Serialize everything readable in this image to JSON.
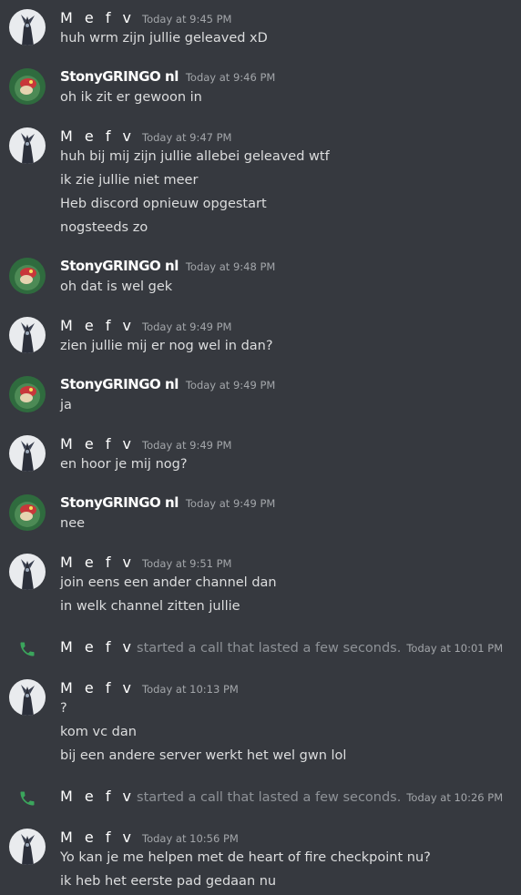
{
  "users": {
    "mefv": "M e f v",
    "stony": "StonyGRINGO nl"
  },
  "messages": [
    {
      "user": "M e f v",
      "time": "Today at 9:45 PM",
      "lines": [
        "huh wrm zijn jullie geleaved xD"
      ]
    },
    {
      "user": "StonyGRINGO nl",
      "time": "Today at 9:46 PM",
      "lines": [
        "oh ik zit er gewoon in"
      ]
    },
    {
      "user": "M e f v",
      "time": "Today at 9:47 PM",
      "lines": [
        "huh bij mij zijn jullie allebei geleaved wtf",
        "ik zie jullie niet meer",
        "Heb discord opnieuw opgestart",
        "nogsteeds zo"
      ]
    },
    {
      "user": "StonyGRINGO nl",
      "time": "Today at 9:48 PM",
      "lines": [
        "oh dat is wel gek"
      ]
    },
    {
      "user": "M e f v",
      "time": "Today at 9:49 PM",
      "lines": [
        "zien jullie mij er nog wel in dan?"
      ]
    },
    {
      "user": "StonyGRINGO nl",
      "time": "Today at 9:49 PM",
      "lines": [
        "ja"
      ]
    },
    {
      "user": "M e f v",
      "time": "Today at 9:49 PM",
      "lines": [
        "en hoor je mij nog?"
      ]
    },
    {
      "user": "StonyGRINGO nl",
      "time": "Today at 9:49 PM",
      "lines": [
        "nee"
      ]
    },
    {
      "user": "M e f v",
      "time": "Today at 9:51 PM",
      "lines": [
        "join eens een ander channel dan",
        "in welk channel zitten jullie"
      ]
    },
    {
      "user": "M e f v",
      "time": "Today at 10:13 PM",
      "lines": [
        "?",
        "kom vc dan",
        "bij een andere server werkt het wel gwn lol"
      ]
    },
    {
      "user": "M e f v",
      "time": "Today at 10:56 PM",
      "lines": [
        "Yo kan je me helpen met de heart of fire checkpoint nu?",
        "ik heb het eerste pad gedaan nu"
      ]
    }
  ],
  "calls": [
    {
      "user": "M e f v",
      "text": "started a call that lasted a few seconds.",
      "time": "Today at 10:01 PM"
    },
    {
      "user": "M e f v",
      "text": "started a call that lasted a few seconds.",
      "time": "Today at 10:26 PM"
    }
  ],
  "colors": {
    "background": "#36393f",
    "call_icon": "#3ba55c"
  },
  "icons": {
    "mefv_avatar": "dark-figure-avatar-icon",
    "stony_avatar": "green-red-creature-avatar-icon",
    "call": "phone-icon"
  }
}
